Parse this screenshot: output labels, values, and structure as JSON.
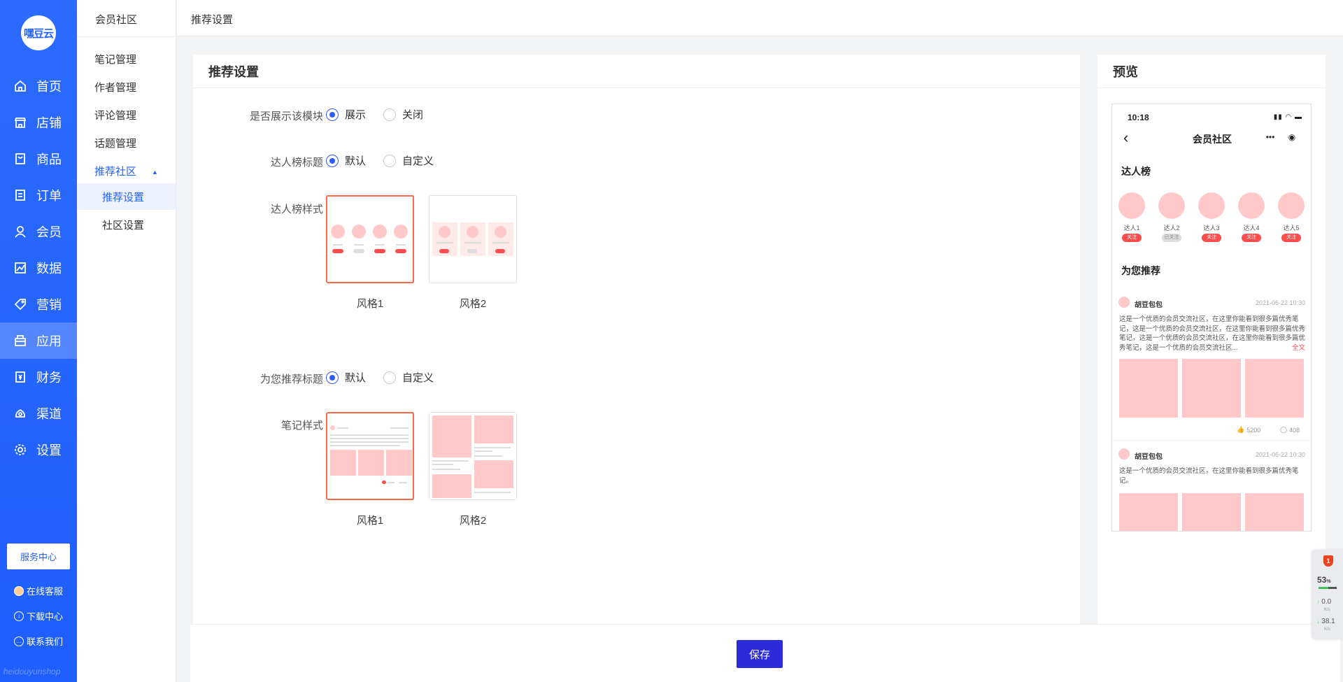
{
  "brand": {
    "logo_text": "嘿豆云",
    "watermark": "heidouyunshop"
  },
  "nav": {
    "items": [
      {
        "label": "首页",
        "icon": "home-icon"
      },
      {
        "label": "店铺",
        "icon": "store-icon"
      },
      {
        "label": "商品",
        "icon": "goods-icon"
      },
      {
        "label": "订单",
        "icon": "order-icon"
      },
      {
        "label": "会员",
        "icon": "member-icon"
      },
      {
        "label": "数据",
        "icon": "chart-icon"
      },
      {
        "label": "营销",
        "icon": "tag-icon"
      },
      {
        "label": "应用",
        "icon": "app-icon",
        "active": true
      },
      {
        "label": "财务",
        "icon": "finance-icon"
      },
      {
        "label": "渠道",
        "icon": "channel-icon"
      },
      {
        "label": "设置",
        "icon": "gear-icon"
      }
    ],
    "service_center": "服务中心",
    "links": [
      {
        "label": "在线客服",
        "icon": "customer-service-icon"
      },
      {
        "label": "下载中心",
        "icon": "download-icon"
      },
      {
        "label": "联系我们",
        "icon": "contact-icon"
      }
    ]
  },
  "subnav": {
    "title": "会员社区",
    "items": [
      "笔记管理",
      "作者管理",
      "评论管理",
      "话题管理"
    ],
    "open_group": "推荐社区",
    "children": [
      {
        "label": "推荐设置",
        "active": true
      },
      {
        "label": "社区设置",
        "active": false
      }
    ]
  },
  "header": {
    "breadcrumb": "推荐设置"
  },
  "settings": {
    "title": "推荐设置",
    "show_module": {
      "label": "是否展示该模块",
      "options": [
        "展示",
        "关闭"
      ],
      "selected": "展示"
    },
    "talent_title": {
      "label": "达人榜标题",
      "options": [
        "默认",
        "自定义"
      ],
      "selected": "默认"
    },
    "talent_style": {
      "label": "达人榜样式",
      "options": [
        "风格1",
        "风格2"
      ],
      "selected": "风格1"
    },
    "recommend_title": {
      "label": "为您推荐标题",
      "options": [
        "默认",
        "自定义"
      ],
      "selected": "默认"
    },
    "note_style": {
      "label": "笔记样式",
      "options": [
        "风格1",
        "风格2"
      ],
      "selected": "风格1"
    },
    "save_label": "保存"
  },
  "preview": {
    "title": "预览",
    "phone": {
      "time": "10:18",
      "status_icons": "signal-wifi-battery-icons",
      "page_title": "会员社区",
      "talent_section": "达人榜",
      "talents": [
        {
          "name": "达人1",
          "follow": "关注",
          "followed": false
        },
        {
          "name": "达人2",
          "follow": "已关注",
          "followed": true
        },
        {
          "name": "达人3",
          "follow": "关注",
          "followed": false
        },
        {
          "name": "达人4",
          "follow": "关注",
          "followed": false
        },
        {
          "name": "达人5",
          "follow": "关注",
          "followed": false
        }
      ],
      "recommend_section": "为您推荐",
      "posts": [
        {
          "author": "胡豆包包",
          "time": "2021-06-22 10:30",
          "text": "这是一个优质的会员交流社区，在这里你能看到很多篇优秀笔记，这是一个优质的会员交流社区，在这里你能看到很多篇优秀笔记，这是一个优质的会员交流社区，在这里你能看到很多篇优秀笔记，这是一个优质的会员交流社区...",
          "more": "全文",
          "likes": "5200",
          "comments": "408"
        },
        {
          "author": "胡豆包包",
          "time": "2021-06-22 10:30",
          "text": "这是一个优质的会员交流社区，在这里你能看到很多篇优秀笔记。"
        }
      ]
    }
  },
  "widget": {
    "badge": "1",
    "percent": "53",
    "percent_unit": "%",
    "up_rate": "0.0",
    "down_rate": "38.1",
    "rate_unit": "K/s"
  }
}
